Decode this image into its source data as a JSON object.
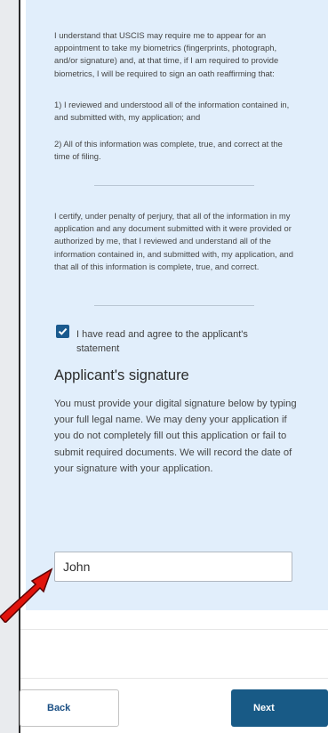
{
  "statements": {
    "biometrics": "I understand that USCIS may require me to appear for an appointment to take my biometrics (fingerprints, photograph, and/or signature) and, at that time, if I am required to provide biometrics, I will be required to sign an oath reaffirming that:",
    "item1": "1) I reviewed and understood all of the information contained in, and submitted with, my application; and",
    "item2": "2) All of this information was complete, true, and correct at the time of filing.",
    "certify": "I certify, under penalty of perjury, that all of the information in my application and any document submitted with it were provided or authorized by me, that I reviewed and understand all of the information contained in, and submitted with, my application, and that all of this information is complete, true, and correct."
  },
  "agreement": {
    "checked": true,
    "label": "I have read and agree to the applicant's statement",
    "checkbox_icon": "checkmark-icon"
  },
  "signature": {
    "title": "Applicant's signature",
    "instructions": "You must provide your digital signature below by typing your full legal name. We may deny your application if you do not completely fill out this application or fail to submit required documents. We will record the date of your signature with your application.",
    "value": "John"
  },
  "navigation": {
    "back_label": "Back",
    "next_label": "Next"
  },
  "annotation": {
    "icon": "red-arrow-icon",
    "color": "#e0140c"
  },
  "colors": {
    "panel_background": "#e1eefb",
    "primary_button": "#185a86",
    "checkbox": "#1a5a8e"
  }
}
